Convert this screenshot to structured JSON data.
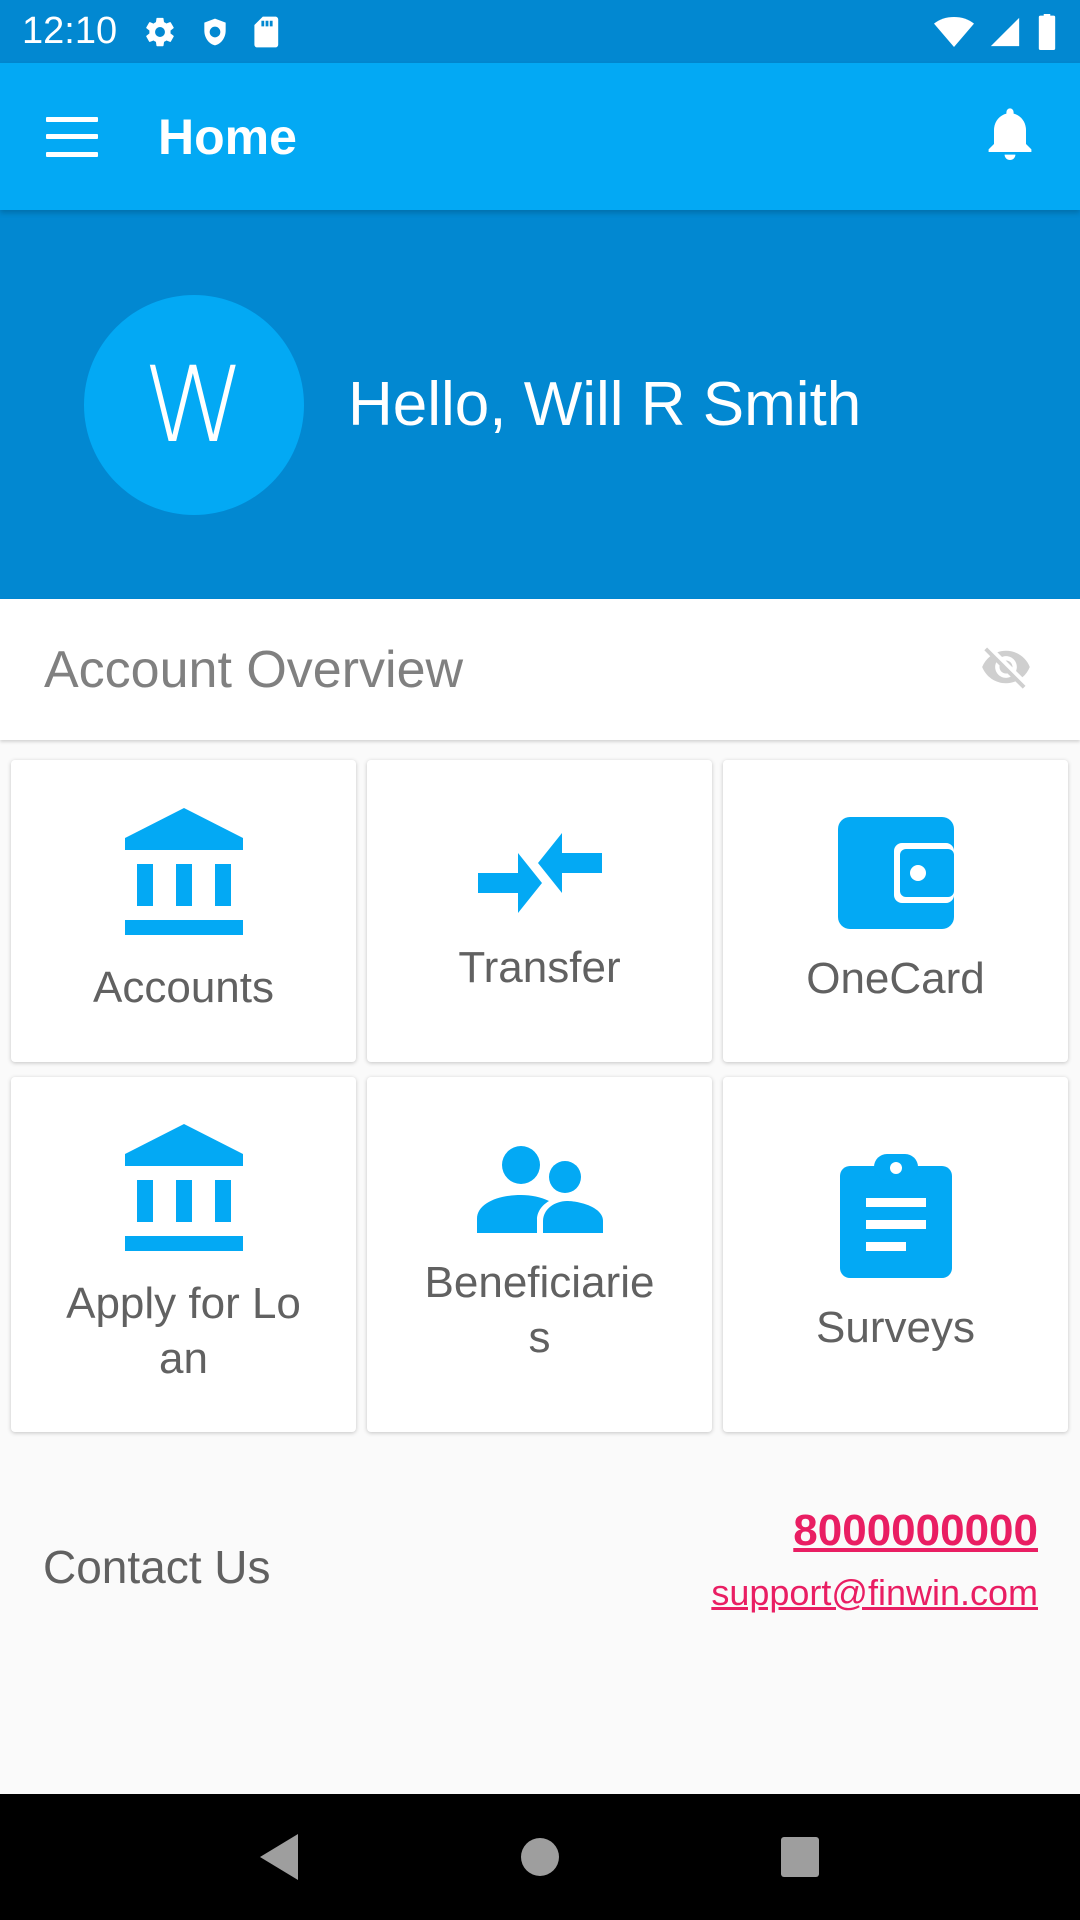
{
  "status_bar": {
    "time": "12:10",
    "left_icons": [
      "settings-icon",
      "shield-icon",
      "sd-card-icon"
    ],
    "right_icons": [
      "wifi-icon",
      "signal-icon",
      "battery-icon"
    ]
  },
  "app_bar": {
    "title": "Home",
    "menu_icon": "menu-icon",
    "notification_icon": "bell-icon"
  },
  "greeting": {
    "avatar_initial": "W",
    "text": "Hello, Will R Smith"
  },
  "overview": {
    "title": "Account Overview",
    "toggle_icon": "visibility-off-icon"
  },
  "tiles": [
    {
      "label": "Accounts",
      "icon": "bank-icon"
    },
    {
      "label": "Transfer",
      "icon": "transfer-icon"
    },
    {
      "label": "OneCard",
      "icon": "wallet-icon"
    },
    {
      "label": "Apply for Loan",
      "icon": "bank-icon"
    },
    {
      "label": "Beneficiaries",
      "icon": "people-icon"
    },
    {
      "label": "Surveys",
      "icon": "clipboard-icon"
    }
  ],
  "contact": {
    "label": "Contact Us",
    "phone": "8000000000",
    "email": "support@finwin.com"
  },
  "colors": {
    "primary": "#03a9f4",
    "primary_dark": "#0288d1",
    "accent": "#e91e63",
    "text_grey": "#616161"
  },
  "nav_bar": [
    "back-icon",
    "home-icon",
    "recents-icon"
  ]
}
